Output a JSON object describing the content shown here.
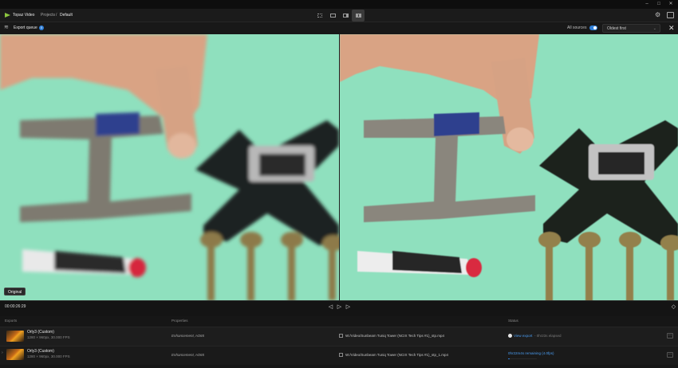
{
  "app": {
    "name": "Topaz Video"
  },
  "breadcrumb": {
    "projects": "Projects",
    "separator": "/",
    "current": "Default"
  },
  "window_controls": {
    "minimize": "–",
    "maximize": "□",
    "close": "✕"
  },
  "queue": {
    "label": "Export queue",
    "count": "0",
    "all_sources_label": "All sources",
    "all_sources_on": true,
    "sort_value": "Oldest first"
  },
  "preview": {
    "left_label": "Original"
  },
  "timeline": {
    "timecode": "00:00:26:29"
  },
  "table": {
    "headers": {
      "exports": "Exports",
      "properties": "Properties",
      "status": "Status"
    },
    "rows": [
      {
        "title": "Orly3 (Custom)",
        "subtitle": "1280 × 960px, 30.000 FPS",
        "properties": "Enhancement, H265",
        "path": "W:/Video/Sunbeam Tuniq Tower (NCIX Tech Tips #1)_stp.mp4",
        "status_link": "View export",
        "status_time": "- 0hr23s elapsed"
      },
      {
        "title": "Orly3 (Custom)",
        "subtitle": "1280 × 960px, 30.000 FPS",
        "properties": "Enhancement, H265",
        "path": "W:/Video/Sunbeam Tuniq Tower (NCIX Tech Tips #1)_stp_1.mp4",
        "status_remaining": "0hr22m4s remaining (4.0fps)",
        "progress": 0.05
      }
    ]
  },
  "colors": {
    "accent": "#2f7fd9",
    "logo": "#8cc63f",
    "background": "#141414",
    "screen": "#8fe0be"
  }
}
